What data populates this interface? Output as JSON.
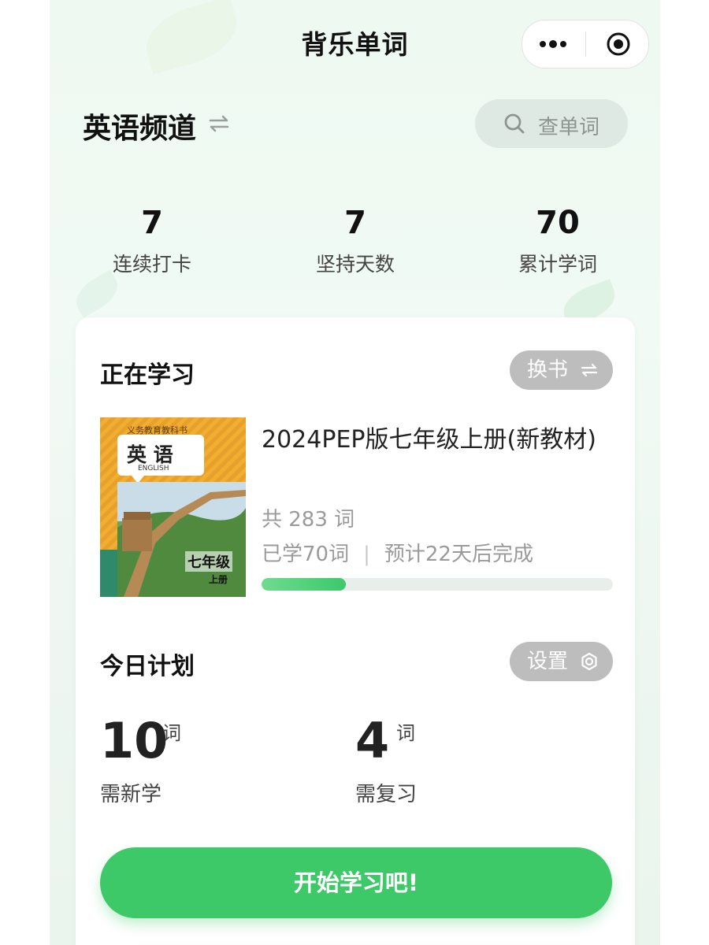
{
  "app_title": "背乐单词",
  "channel": {
    "title": "英语频道"
  },
  "search": {
    "label": "查单词"
  },
  "stats": [
    {
      "value": "7",
      "label": "连续打卡"
    },
    {
      "value": "7",
      "label": "坚持天数"
    },
    {
      "value": "70",
      "label": "累计学词"
    }
  ],
  "studying": {
    "section_title": "正在学习",
    "switch_label": "换书",
    "book": {
      "title": "2024PEP版七年级上册(新教材)",
      "total": "共 283 词",
      "learned": "已学70词",
      "eta": "预计22天后完成",
      "progress": 0.24,
      "cover": {
        "header": "义务教育教科书",
        "subject": "英 语",
        "subject_en": "ENGLISH",
        "grade": "七年级",
        "volume": "上册"
      }
    }
  },
  "plan": {
    "section_title": "今日计划",
    "settings_label": "设置",
    "new_count": "10",
    "new_unit": "词",
    "new_label": "需新学",
    "review_count": "4",
    "review_unit": "词",
    "review_label": "需复习"
  },
  "start_button": "开始学习吧!",
  "colors": {
    "accent": "#3dc968",
    "highlight": "#fdf28c",
    "pill_gray": "#bdbdbd"
  }
}
